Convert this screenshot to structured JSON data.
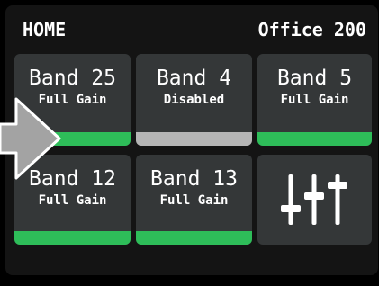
{
  "header": {
    "title": "HOME",
    "location": "Office 200"
  },
  "tiles": [
    {
      "name": "Band 25",
      "status": "Full Gain",
      "bar_color": "#2ebd59"
    },
    {
      "name": "Band 4",
      "status": "Disabled",
      "bar_color": "#b5b5b5"
    },
    {
      "name": "Band 5",
      "status": "Full Gain",
      "bar_color": "#2ebd59"
    },
    {
      "name": "Band 12",
      "status": "Full Gain",
      "bar_color": "#2ebd59"
    },
    {
      "name": "Band 13",
      "status": "Full Gain",
      "bar_color": "#2ebd59"
    }
  ],
  "settings_tile": {
    "icon": "equalizer-sliders-icon"
  },
  "pointer": {
    "icon": "arrow-pointer-icon"
  },
  "colors": {
    "background": "#000000",
    "screen": "#141414",
    "tile": "#343738",
    "active_bar": "#2ebd59",
    "disabled_bar": "#b5b5b5",
    "text": "#ffffff",
    "pointer_fill": "#a3a3a3"
  }
}
